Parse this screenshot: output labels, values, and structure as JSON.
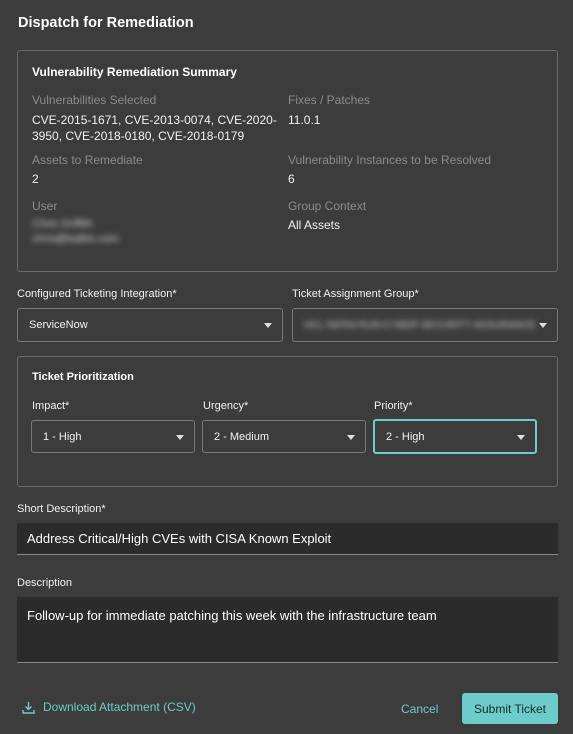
{
  "dialog": {
    "title": "Dispatch for Remediation"
  },
  "summary": {
    "title": "Vulnerability Remediation Summary",
    "vulns_label": "Vulnerabilities Selected",
    "vulns_line1": "CVE-2015-1671, CVE-2013-0074, CVE-2020-",
    "vulns_line2": "3950, CVE-2018-0180, CVE-2018-0179",
    "fixes_label": "Fixes / Patches",
    "fixes_value": "11.0.1",
    "assets_label": "Assets to Remediate",
    "assets_value": "2",
    "instances_label": "Vulnerability Instances to be Resolved",
    "instances_value": "6",
    "user_label": "User",
    "user_name": "Chris Griffith",
    "user_email": "chris@balbix.com",
    "group_label": "Group Context",
    "group_value": "All Assets"
  },
  "integration": {
    "label": "Configured Ticketing Integration*",
    "value": "ServiceNow"
  },
  "assignment": {
    "label": "Ticket Assignment Group*",
    "value": "HCL INFRA RUN-CYBER SECURITY ASSURANCE"
  },
  "prioritization": {
    "title": "Ticket Prioritization",
    "impact_label": "Impact*",
    "impact_value": "1 - High",
    "urgency_label": "Urgency*",
    "urgency_value": "2 - Medium",
    "priority_label": "Priority*",
    "priority_value": "2 - High"
  },
  "short_description": {
    "label": "Short Description*",
    "value": "Address Critical/High CVEs with CISA Known Exploit"
  },
  "description": {
    "label": "Description",
    "value": "Follow-up for immediate patching this week with the infrastructure team"
  },
  "footer": {
    "download_label": "Download Attachment (CSV)",
    "cancel_label": "Cancel",
    "submit_label": "Submit Ticket"
  },
  "colors": {
    "accent": "#6ccbcb",
    "background": "#3c3c3c"
  }
}
